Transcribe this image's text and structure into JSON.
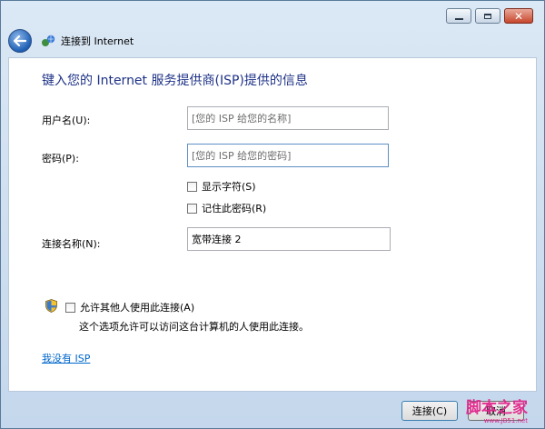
{
  "window": {
    "title": "连接到 Internet",
    "caption_buttons": [
      "minimize",
      "maximize",
      "close"
    ]
  },
  "content": {
    "heading": "键入您的 Internet 服务提供商(ISP)提供的信息",
    "username": {
      "label": "用户名(U):",
      "placeholder": "[您的 ISP 给您的名称]",
      "value": ""
    },
    "password": {
      "label": "密码(P):",
      "placeholder": "[您的 ISP 给您的密码]",
      "value": ""
    },
    "show_chars": {
      "label": "显示字符(S)",
      "checked": false
    },
    "remember_pw": {
      "label": "记住此密码(R)",
      "checked": false
    },
    "connection_name": {
      "label": "连接名称(N):",
      "value": "宽带连接 2"
    },
    "allow_others": {
      "label": "允许其他人使用此连接(A)",
      "checked": false
    },
    "allow_hint": "这个选项允许可以访问这台计算机的人使用此连接。",
    "no_isp_link": "我没有 ISP"
  },
  "footer": {
    "connect_label": "连接(C)",
    "cancel_label": "取消"
  },
  "watermark": {
    "main": "脚本之家",
    "sub": "www.JB51.net"
  },
  "colors": {
    "heading": "#1e3287",
    "link": "#0066cc",
    "watermark": "#e0218a"
  },
  "icons": {
    "back": "back-arrow-icon",
    "app": "network-globe-icon",
    "shield": "uac-shield-icon"
  }
}
